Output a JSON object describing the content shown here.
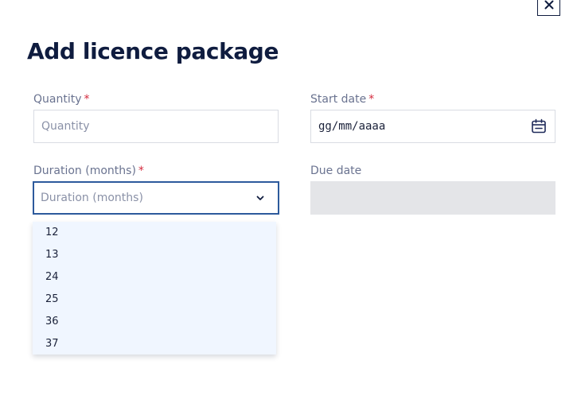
{
  "dialog": {
    "title": "Add licence package",
    "close_icon": "close-icon"
  },
  "fields": {
    "quantity": {
      "label": "Quantity",
      "required_mark": "*",
      "placeholder": "Quantity"
    },
    "start_date": {
      "label": "Start date",
      "required_mark": "*",
      "value": "gg/mm/aaaa",
      "icon": "calendar-icon"
    },
    "duration": {
      "label": "Duration (months)",
      "required_mark": "*",
      "placeholder": "Duration (months)",
      "icon": "chevron-down-icon",
      "options": [
        "12",
        "13",
        "24",
        "25",
        "36",
        "37"
      ]
    },
    "due_date": {
      "label": "Due date",
      "value": ""
    }
  },
  "colors": {
    "heading": "#0f1c3f",
    "label": "#6a7390",
    "required": "#d42a3d",
    "focus_border": "#2d5a9c",
    "dropdown_bg": "#f0f6ff",
    "disabled_bg": "#e4e5e8"
  }
}
